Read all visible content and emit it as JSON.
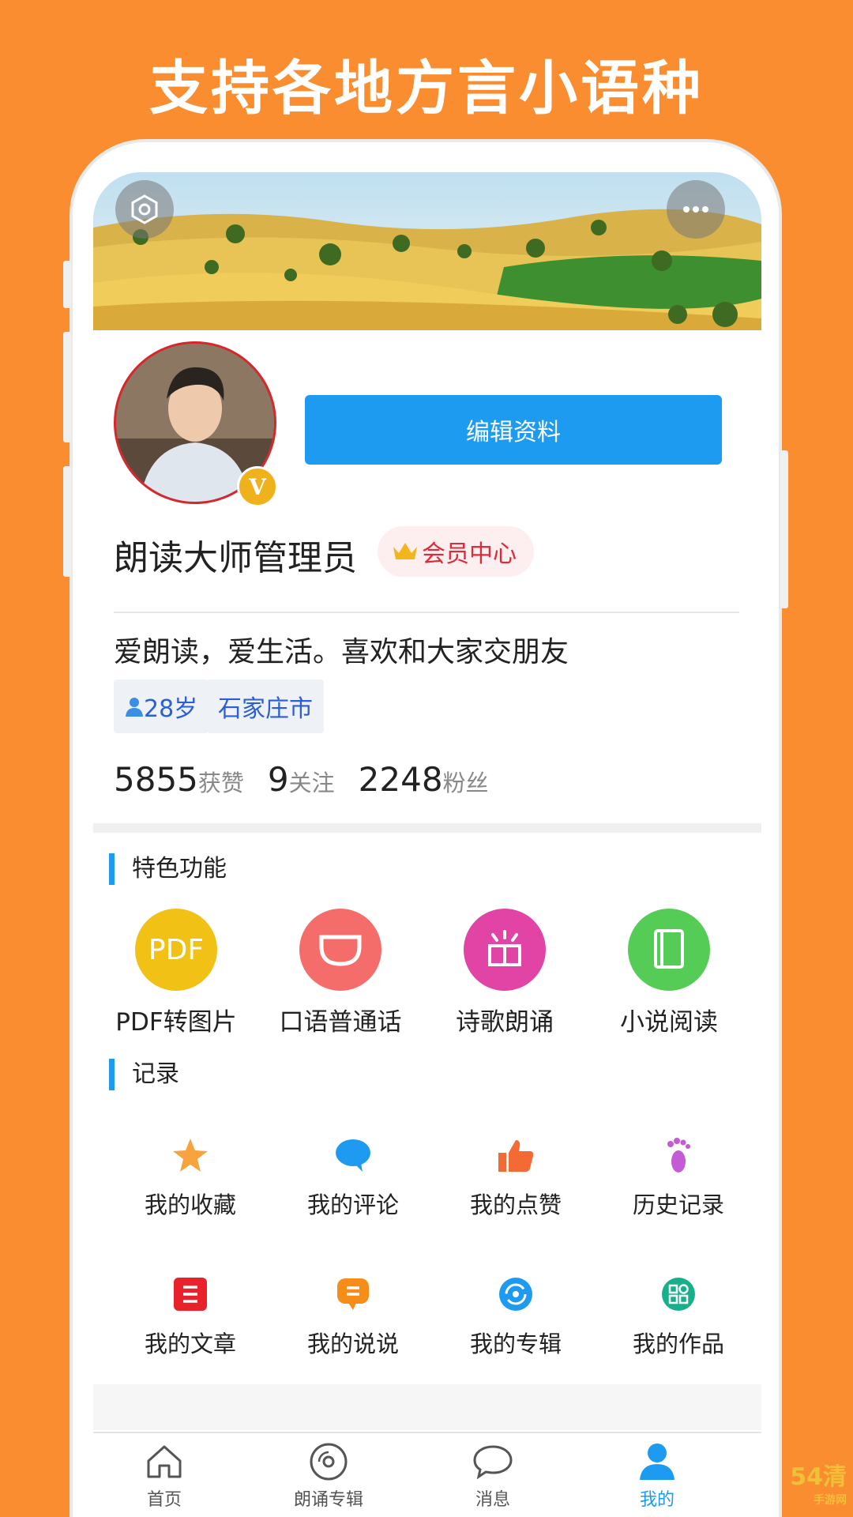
{
  "promo": {
    "headline": "支持各地方言小语种"
  },
  "profile": {
    "edit_label": "编辑资料",
    "badge_letter": "V",
    "username": "朗读大师管理员",
    "vip_label": "会员中心",
    "bio": "爱朗读，爱生活。喜欢和大家交朋友",
    "age_tag": "28岁",
    "city_tag": "石家庄市"
  },
  "stats": [
    {
      "value": "5855",
      "label": "获赞"
    },
    {
      "value": "9",
      "label": "关注"
    },
    {
      "value": "2248",
      "label": "粉丝"
    }
  ],
  "features": {
    "title": "特色功能",
    "pdf_text": "PDF",
    "items": [
      {
        "label": "PDF转图片",
        "color": "#f2c116",
        "icon": "pdf-icon"
      },
      {
        "label": "口语普通话",
        "color": "#f56d6a",
        "icon": "mouth-icon"
      },
      {
        "label": "诗歌朗诵",
        "color": "#e244a6",
        "icon": "reading-book-icon"
      },
      {
        "label": "小说阅读",
        "color": "#55cc56",
        "icon": "book-icon"
      }
    ]
  },
  "records": {
    "title": "记录",
    "items": [
      {
        "label": "我的收藏",
        "icon": "star-icon",
        "color": "#f7a440"
      },
      {
        "label": "我的评论",
        "icon": "comment-icon",
        "color": "#1e9af0"
      },
      {
        "label": "我的点赞",
        "icon": "thumbs-up-icon",
        "color": "#f36a35"
      },
      {
        "label": "历史记录",
        "icon": "footprint-icon",
        "color": "#c45ad6"
      },
      {
        "label": "我的文章",
        "icon": "article-icon",
        "color": "#e8212a"
      },
      {
        "label": "我的说说",
        "icon": "message-icon",
        "color": "#f58d18"
      },
      {
        "label": "我的专辑",
        "icon": "album-icon",
        "color": "#1e9af0"
      },
      {
        "label": "我的作品",
        "icon": "works-icon",
        "color": "#18b08a"
      }
    ]
  },
  "tabbar": {
    "items": [
      {
        "label": "首页",
        "icon": "home-icon"
      },
      {
        "label": "朗诵专辑",
        "icon": "disc-icon"
      },
      {
        "label": "消息",
        "icon": "chat-icon"
      },
      {
        "label": "我的",
        "icon": "person-icon",
        "active": true
      }
    ],
    "active_color": "#1d9bf0"
  },
  "watermark": {
    "text": "54清",
    "sub": "手游网"
  }
}
